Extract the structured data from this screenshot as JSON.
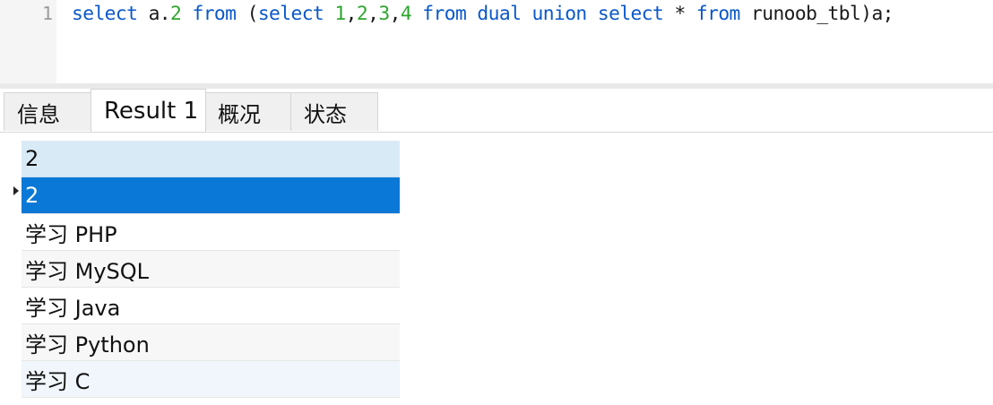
{
  "editor": {
    "line_number": "1",
    "tokens": [
      {
        "t": "select",
        "c": "kw"
      },
      {
        "t": " a.",
        "c": "txt"
      },
      {
        "t": "2",
        "c": "num"
      },
      {
        "t": " ",
        "c": "txt"
      },
      {
        "t": "from",
        "c": "kw"
      },
      {
        "t": " (",
        "c": "txt"
      },
      {
        "t": "select",
        "c": "kw"
      },
      {
        "t": " ",
        "c": "txt"
      },
      {
        "t": "1",
        "c": "num"
      },
      {
        "t": ",",
        "c": "txt"
      },
      {
        "t": "2",
        "c": "num"
      },
      {
        "t": ",",
        "c": "txt"
      },
      {
        "t": "3",
        "c": "num"
      },
      {
        "t": ",",
        "c": "txt"
      },
      {
        "t": "4",
        "c": "num"
      },
      {
        "t": " ",
        "c": "txt"
      },
      {
        "t": "from",
        "c": "kw"
      },
      {
        "t": " ",
        "c": "txt"
      },
      {
        "t": "dual",
        "c": "kw"
      },
      {
        "t": " ",
        "c": "txt"
      },
      {
        "t": "union",
        "c": "kw"
      },
      {
        "t": " ",
        "c": "txt"
      },
      {
        "t": "select",
        "c": "kw"
      },
      {
        "t": " * ",
        "c": "txt"
      },
      {
        "t": "from",
        "c": "kw"
      },
      {
        "t": " runoob_tbl)a;",
        "c": "txt"
      }
    ]
  },
  "tabs": [
    {
      "label": "信息",
      "active": false
    },
    {
      "label": "Result 1",
      "active": true
    },
    {
      "label": "概况",
      "active": false
    },
    {
      "label": "状态",
      "active": false
    }
  ],
  "grid": {
    "header": "2",
    "rows": [
      "2",
      "学习 PHP",
      "学习 MySQL",
      "学习 Java",
      "学习 Python",
      "学习 C"
    ],
    "selected_row": 0
  },
  "colors": {
    "keyword": "#0a58c9",
    "number": "#2ea52e",
    "selection": "#0a78d7",
    "header": "#d9eaf7"
  }
}
